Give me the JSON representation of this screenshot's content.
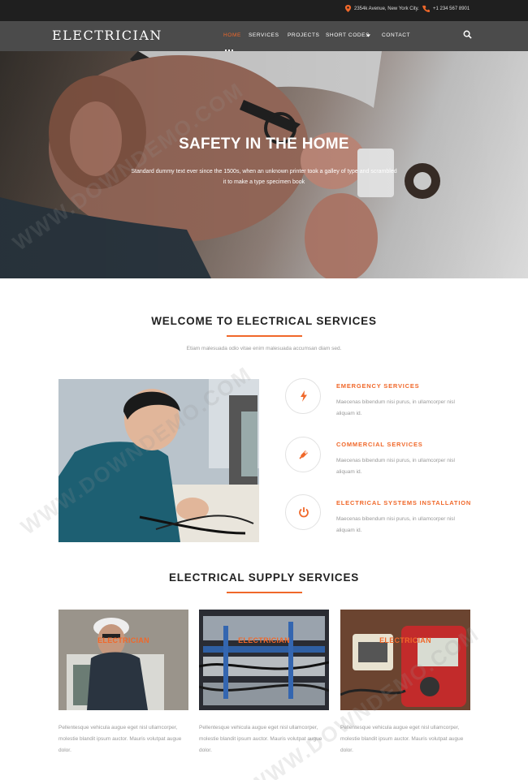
{
  "topbar": {
    "address": "2354k Avenue, New York City.",
    "phone": "+1 234 567 8901"
  },
  "nav": {
    "logo": "ELECTRICIAN",
    "items": [
      "HOME",
      "SERVICES",
      "PROJECTS",
      "SHORT CODES",
      "CONTACT"
    ],
    "active_index": 0
  },
  "hero": {
    "title": "SAFETY IN THE HOME",
    "text": "Standard dummy text ever since the 1500s, when an unknown printer took a galley of type and scrambled it to make a type specimen book"
  },
  "welcome": {
    "title": "WELCOME TO ELECTRICAL SERVICES",
    "subtitle": "Etiam malesuada odio vitae enim malesuada accumsan diam sed."
  },
  "services": [
    {
      "icon": "lightning-icon",
      "title": "EMERGENCY SERVICES",
      "text": "Maecenas bibendum nisi purus, in ullamcorper nisl aliquam id."
    },
    {
      "icon": "plug-icon",
      "title": "COMMERCIAL SERVICES",
      "text": "Maecenas bibendum nisi purus, in ullamcorper nisl aliquam id."
    },
    {
      "icon": "power-icon",
      "title": "ELECTRICAL SYSTEMS INSTALLATION",
      "text": "Maecenas bibendum nisi purus, in ullamcorper nisl aliquam id."
    }
  ],
  "supply": {
    "title": "ELECTRICAL SUPPLY SERVICES",
    "cards": [
      {
        "label": "ELECTRICIAN",
        "text": "Pellentesque vehicula augue eget nisl ullamcorper, molestie blandit ipsum auctor. Mauris volutpat augue dolor."
      },
      {
        "label": "ELECTRICIAN",
        "text": "Pellentesque vehicula augue eget nisl ullamcorper, molestie blandit ipsum auctor. Mauris volutpat augue dolor."
      },
      {
        "label": "ELECTRICIAN",
        "text": "Pellentesque vehicula augue eget nisl ullamcorper, molestie blandit ipsum auctor. Mauris volutpat augue dolor."
      }
    ]
  },
  "watermark": "WWW.DOWNDEMO.COM",
  "colors": {
    "accent": "#f0682a",
    "topbar": "#1f1f1f",
    "nav": "#3c3c3c"
  }
}
